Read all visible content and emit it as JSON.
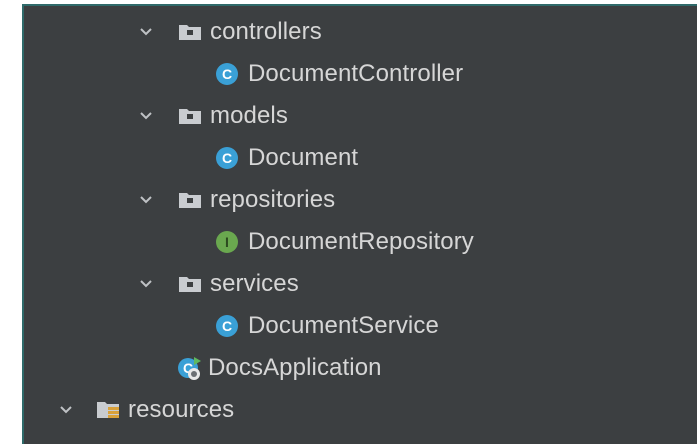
{
  "project_tree": {
    "items": [
      {
        "label": "controllers",
        "kind": "folder",
        "expanded": true
      },
      {
        "label": "DocumentController",
        "kind": "class"
      },
      {
        "label": "models",
        "kind": "folder",
        "expanded": true
      },
      {
        "label": "Document",
        "kind": "class"
      },
      {
        "label": "repositories",
        "kind": "folder",
        "expanded": true
      },
      {
        "label": "DocumentRepository",
        "kind": "interface"
      },
      {
        "label": "services",
        "kind": "folder",
        "expanded": true
      },
      {
        "label": "DocumentService",
        "kind": "class"
      },
      {
        "label": "DocsApplication",
        "kind": "spring-boot-application"
      },
      {
        "label": "resources",
        "kind": "resources-folder",
        "expanded": true
      }
    ],
    "class_badge_letter": "C",
    "interface_badge_letter": "I"
  },
  "colors": {
    "panel_background": "#3c3f41",
    "text": "#d6d6d6",
    "class_badge": "#3aa0d6",
    "interface_badge": "#6aa84f",
    "folder": "#c9ccd0",
    "resources_folder_accent": "#d9a13a"
  }
}
